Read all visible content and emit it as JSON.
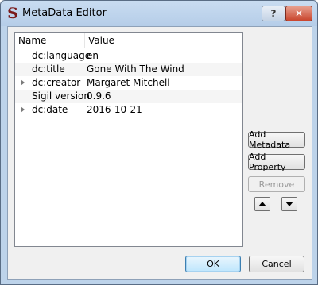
{
  "window": {
    "title": "MetaData Editor",
    "app_icon_glyph": "S",
    "help_label": "?",
    "close_label": "✕"
  },
  "table": {
    "columns": [
      "Name",
      "Value"
    ],
    "rows": [
      {
        "name": "dc:language",
        "value": "en",
        "expandable": false
      },
      {
        "name": "dc:title",
        "value": "Gone With The Wind",
        "expandable": false
      },
      {
        "name": "dc:creator",
        "value": "Margaret Mitchell",
        "expandable": true
      },
      {
        "name": "Sigil version",
        "value": "0.9.6",
        "expandable": false
      },
      {
        "name": "dc:date",
        "value": "2016-10-21",
        "expandable": true
      }
    ]
  },
  "side_buttons": {
    "add_metadata": "Add Metadata",
    "add_property": "Add Property",
    "remove": "Remove"
  },
  "dialog_buttons": {
    "ok": "OK",
    "cancel": "Cancel"
  },
  "icons": {
    "app": "sigil-logo-icon",
    "move_up": "arrow-up-icon",
    "move_down": "arrow-down-icon",
    "expand": "expand-arrow-icon"
  },
  "colors": {
    "titlebar": "#bdd3ea",
    "close_button": "#c9452d",
    "client_bg": "#f0f0f0",
    "alt_row": "#f5f5f5"
  }
}
